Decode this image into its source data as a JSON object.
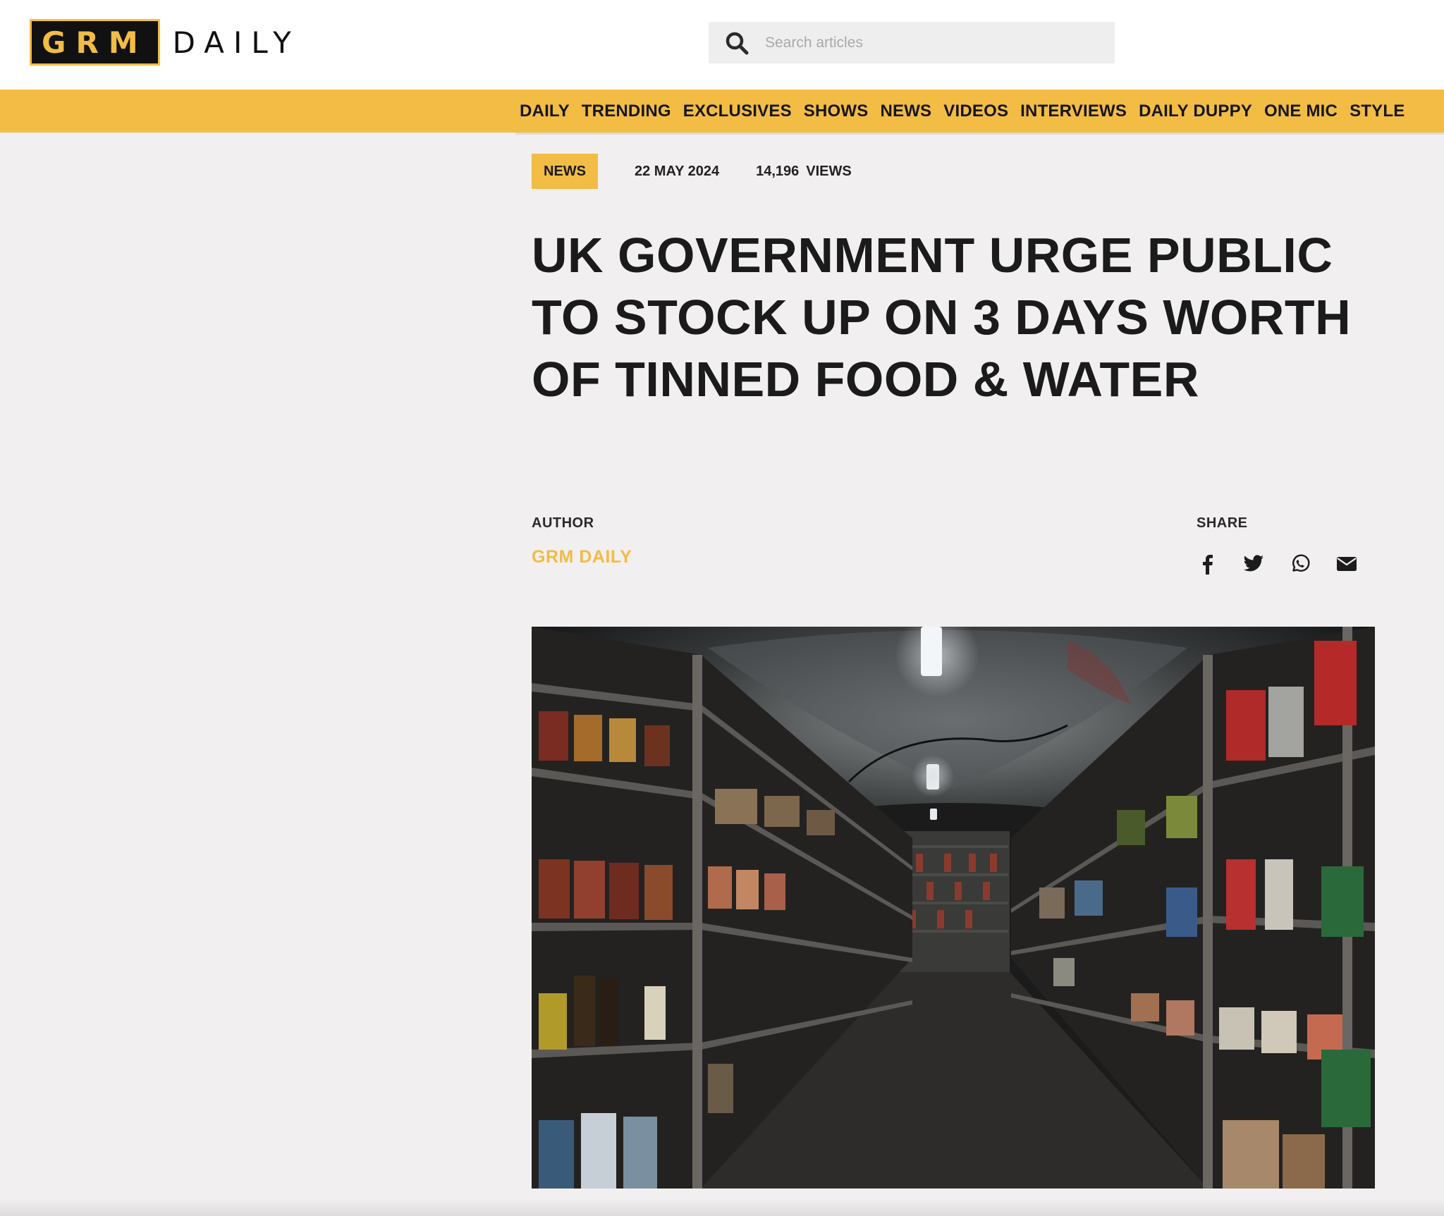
{
  "header": {
    "logo": {
      "left": "GRM",
      "right": "DAILY"
    },
    "search": {
      "placeholder": "Search articles",
      "icon": "search-icon"
    }
  },
  "nav": {
    "items": [
      "DAILY",
      "TRENDING",
      "EXCLUSIVES",
      "SHOWS",
      "NEWS",
      "VIDEOS",
      "INTERVIEWS",
      "DAILY DUPPY",
      "ONE MIC",
      "STYLE"
    ]
  },
  "article": {
    "category": "NEWS",
    "date": "22 MAY 2024",
    "views_count": "14,196",
    "views_label": "VIEWS",
    "title": "UK GOVERNMENT URGE PUBLIC TO STOCK UP ON 3 DAYS WORTH OF TINNED FOOD & WATER",
    "author_label": "AUTHOR",
    "author_name": "GRM DAILY",
    "share_label": "SHARE",
    "share_icons": [
      "facebook-icon",
      "twitter-icon",
      "whatsapp-icon",
      "email-icon"
    ]
  },
  "colors": {
    "accent": "#f2bc45",
    "background": "#f1eff0",
    "text": "#1c1c1c"
  }
}
